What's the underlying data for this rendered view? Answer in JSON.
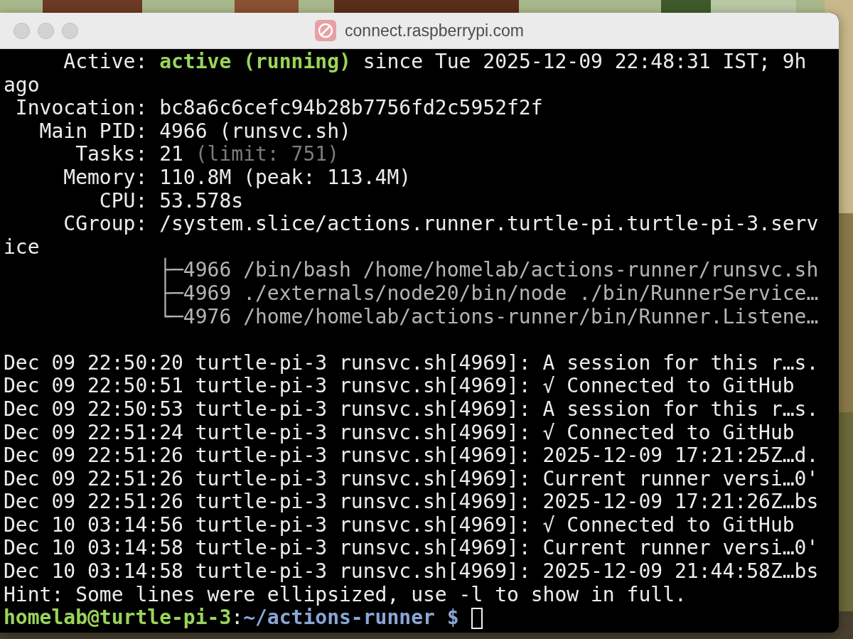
{
  "window": {
    "title": "connect.raspberrypi.com"
  },
  "terminal": {
    "lines": [
      {
        "kind": "text",
        "segments": [
          {
            "text": "     Active: ",
            "kind": "normal"
          },
          {
            "text": "active (running)",
            "kind": "highlight"
          },
          {
            "text": " since Tue 2025-12-09 22:48:31 IST; 9h",
            "kind": "normal"
          }
        ]
      },
      {
        "kind": "text",
        "segments": [
          {
            "text": "ago",
            "kind": "normal"
          }
        ]
      },
      {
        "kind": "text",
        "segments": [
          {
            "text": " Invocation: bc8a6c6cefc94b28b7756fd2c5952f2f",
            "kind": "normal"
          }
        ]
      },
      {
        "kind": "text",
        "segments": [
          {
            "text": "   Main PID: 4966 (runsvc.sh)",
            "kind": "normal"
          }
        ]
      },
      {
        "kind": "text",
        "segments": [
          {
            "text": "      Tasks: 21 ",
            "kind": "normal"
          },
          {
            "text": "(limit: 751)",
            "kind": "dim"
          }
        ]
      },
      {
        "kind": "text",
        "segments": [
          {
            "text": "     Memory: 110.8M (peak: 113.4M)",
            "kind": "normal"
          }
        ]
      },
      {
        "kind": "text",
        "segments": [
          {
            "text": "        CPU: 53.578s",
            "kind": "normal"
          }
        ]
      },
      {
        "kind": "text",
        "segments": [
          {
            "text": "     CGroup: /system.slice/actions.runner.turtle-pi.turtle-pi-3.serv",
            "kind": "normal"
          }
        ]
      },
      {
        "kind": "text",
        "segments": [
          {
            "text": "ice",
            "kind": "normal"
          }
        ]
      },
      {
        "kind": "text",
        "segments": [
          {
            "text": "             ├─4966 /bin/bash /home/homelab/actions-runner/runsvc.sh",
            "kind": "tree"
          }
        ]
      },
      {
        "kind": "text",
        "segments": [
          {
            "text": "             ├─4969 ./externals/node20/bin/node ./bin/RunnerService…",
            "kind": "tree"
          }
        ]
      },
      {
        "kind": "text",
        "segments": [
          {
            "text": "             └─4976 /home/homelab/actions-runner/bin/Runner.Listene…",
            "kind": "tree"
          }
        ]
      },
      {
        "kind": "blank"
      },
      {
        "kind": "text",
        "segments": [
          {
            "text": "Dec 09 22:50:20 turtle-pi-3 runsvc.sh[4969]: A session for this r…s.",
            "kind": "normal"
          }
        ]
      },
      {
        "kind": "text",
        "segments": [
          {
            "text": "Dec 09 22:50:51 turtle-pi-3 runsvc.sh[4969]: √ Connected to GitHub",
            "kind": "normal"
          }
        ]
      },
      {
        "kind": "text",
        "segments": [
          {
            "text": "Dec 09 22:50:53 turtle-pi-3 runsvc.sh[4969]: A session for this r…s.",
            "kind": "normal"
          }
        ]
      },
      {
        "kind": "text",
        "segments": [
          {
            "text": "Dec 09 22:51:24 turtle-pi-3 runsvc.sh[4969]: √ Connected to GitHub",
            "kind": "normal"
          }
        ]
      },
      {
        "kind": "text",
        "segments": [
          {
            "text": "Dec 09 22:51:26 turtle-pi-3 runsvc.sh[4969]: 2025-12-09 17:21:25Z…d.",
            "kind": "normal"
          }
        ]
      },
      {
        "kind": "text",
        "segments": [
          {
            "text": "Dec 09 22:51:26 turtle-pi-3 runsvc.sh[4969]: Current runner versi…0'",
            "kind": "normal"
          }
        ]
      },
      {
        "kind": "text",
        "segments": [
          {
            "text": "Dec 09 22:51:26 turtle-pi-3 runsvc.sh[4969]: 2025-12-09 17:21:26Z…bs",
            "kind": "normal"
          }
        ]
      },
      {
        "kind": "text",
        "segments": [
          {
            "text": "Dec 10 03:14:56 turtle-pi-3 runsvc.sh[4969]: √ Connected to GitHub",
            "kind": "normal"
          }
        ]
      },
      {
        "kind": "text",
        "segments": [
          {
            "text": "Dec 10 03:14:58 turtle-pi-3 runsvc.sh[4969]: Current runner versi…0'",
            "kind": "normal"
          }
        ]
      },
      {
        "kind": "text",
        "segments": [
          {
            "text": "Dec 10 03:14:58 turtle-pi-3 runsvc.sh[4969]: 2025-12-09 21:44:58Z…bs",
            "kind": "normal"
          }
        ]
      },
      {
        "kind": "text",
        "segments": [
          {
            "text": "Hint: Some lines were ellipsized, use -l to show in full.",
            "kind": "normal"
          }
        ]
      }
    ],
    "prompt": {
      "user_host": "homelab@turtle-pi-3",
      "separator": ":",
      "path": "~/actions-runner",
      "symbol": " $"
    }
  }
}
